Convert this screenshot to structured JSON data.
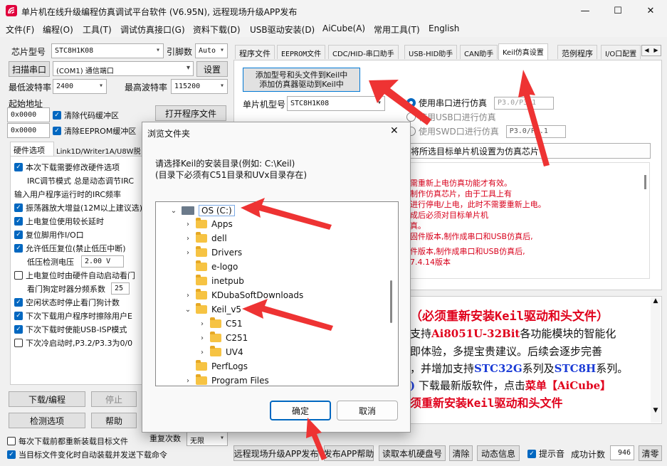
{
  "window": {
    "title": "单片机在线升级编程仿真调试平台软件 (V6.95N), 远程现场升级APP发布",
    "minimize": "—",
    "maximize": "☐",
    "close": "✕"
  },
  "menu": [
    "文件(F)",
    "编程(O)",
    "工具(T)",
    "调试仿真接口(G)",
    "资料下载(D)",
    "USB驱动安装(D)",
    "AiCube(A)",
    "常用工具(T)",
    "English"
  ],
  "left": {
    "chip_label": "芯片型号",
    "chip_value": "STC8H1K08",
    "pins_label": "引脚数",
    "pins_value": "Auto",
    "scan_button": "扫描串口",
    "port_value": "(COM1) 通信端口",
    "settings_button": "设置",
    "min_baud_label": "最低波特率",
    "min_baud_value": "2400",
    "max_baud_label": "最高波特率",
    "max_baud_value": "115200",
    "start_addr_label": "起始地址",
    "addr1": "0x0000",
    "clear_code": "清除代码缓冲区",
    "open_file": "打开程序文件",
    "addr2": "0x0000",
    "clear_eeprom": "清除EEPROM缓冲区",
    "tab1": "硬件选项",
    "tab2": "Link1D/Writer1A/U8W脱",
    "options": [
      "本次下载需要修改硬件选项",
      "IRC调节模式",
      "总是动态调节IRC",
      "输入用户程序运行时的IRC频率",
      "振荡器放大增益(12M以上建议选)",
      "上电复位使用较长延时",
      "复位脚用作I/O口",
      "允许低压复位(禁止低压中断)",
      "低压检测电压",
      "2.00 V",
      "上电复位时由硬件自动启动看门",
      "看门狗定时器分频系数",
      "25",
      "空闲状态时停止看门狗计数",
      "下次下载用户程序时擦除用户E",
      "下次下载时使能USB-ISP模式",
      "下次冷启动时,P3.2/P3.3为0/0"
    ],
    "download_button": "下载/编程",
    "stop_button": "停止",
    "check_button": "检测选项",
    "help_button": "帮助",
    "reload_check": "每次下载前都重新装载目标文件",
    "auto_check": "当目标文件变化时自动装载并发送下载命令",
    "retry_label": "重复次数",
    "retry_value": "无限"
  },
  "right": {
    "tabs": [
      "程序文件",
      "EEPROM文件",
      "CDC/HID-串口助手",
      "USB-HID助手",
      "CAN助手",
      "Keil仿真设置",
      "范例程序",
      "I/O口配置"
    ],
    "add_button_line1": "添加型号和头文件到Keil中",
    "add_button_line2": "添加仿真器驱动到Keil中",
    "mcu_label": "单片机型号",
    "mcu_value": "STC8H1K08",
    "radio1": "使用串口进行仿真",
    "radio1_val": "P3.0/P3.1",
    "radio2": "使用USB口进行仿真",
    "radio3": "使用SWD口进行仿真",
    "radio3_val": "P3.0/P3.1",
    "set_target": "将所选目标单片机设置为仿真芯片",
    "notes": [
      "需重新上电仿真功能才有效。",
      "制作仿真芯片，由于工具上有",
      "进行停电/上电，此时不需要重新上电。",
      "成后必须对目标单片机",
      "真。",
      "固件版本,制作成串口和USB仿真后,",
      "件版本,制作成串口和USB仿真后,",
      "7.4.14版本"
    ],
    "big1": "（必须重新安装Keil驱动和头文件）",
    "big2a": "支持",
    "big2b": "Ai8051U-32Bit",
    "big2c": "各功能模块的智能化",
    "big3": "即体验，多提宝贵建议。后续会逐步完善",
    "big4a": "，并增加支持",
    "big4b": "STC32G",
    "big4c": "系列及",
    "big4d": "STC8H",
    "big4e": "系列。",
    "big5a": "下载最新版软件，点击",
    "big5b": "菜单【AiCube】",
    "big6": "须重新安装Keil驱动和头文件"
  },
  "bottom": {
    "remote_button": "远程现场升级APP发布",
    "help_button": "发布APP帮助",
    "disk_button": "读取本机硬盘号",
    "clear_button": "清除",
    "dynamic_button": "动态信息",
    "sound_label": "提示音",
    "count_label": "成功计数",
    "count_value": "946",
    "reset_button": "清零"
  },
  "dialog": {
    "title": "浏览文件夹",
    "close": "✕",
    "prompt1": "请选择Keil的安装目录(例如: C:\\Keil)",
    "prompt2": "(目录下必须有C51目录和UVx目录存在)",
    "tree": [
      {
        "label": "OS (C:)",
        "level": 0,
        "expanded": true
      },
      {
        "label": "Apps",
        "level": 1
      },
      {
        "label": "dell",
        "level": 1
      },
      {
        "label": "Drivers",
        "level": 1
      },
      {
        "label": "e-logo",
        "level": 1
      },
      {
        "label": "inetpub",
        "level": 1
      },
      {
        "label": "KDubaSoftDownloads",
        "level": 1
      },
      {
        "label": "Keil_v5",
        "level": 1,
        "expanded": true
      },
      {
        "label": "C51",
        "level": 2
      },
      {
        "label": "C251",
        "level": 2
      },
      {
        "label": "UV4",
        "level": 2
      },
      {
        "label": "PerfLogs",
        "level": 1
      },
      {
        "label": "Program Files",
        "level": 1
      }
    ],
    "ok": "确定",
    "cancel": "取消"
  },
  "colors": {
    "accent": "#0067c0",
    "red": "#e0001b",
    "blue": "#1a3bd6",
    "arrow": "#ee3333"
  }
}
